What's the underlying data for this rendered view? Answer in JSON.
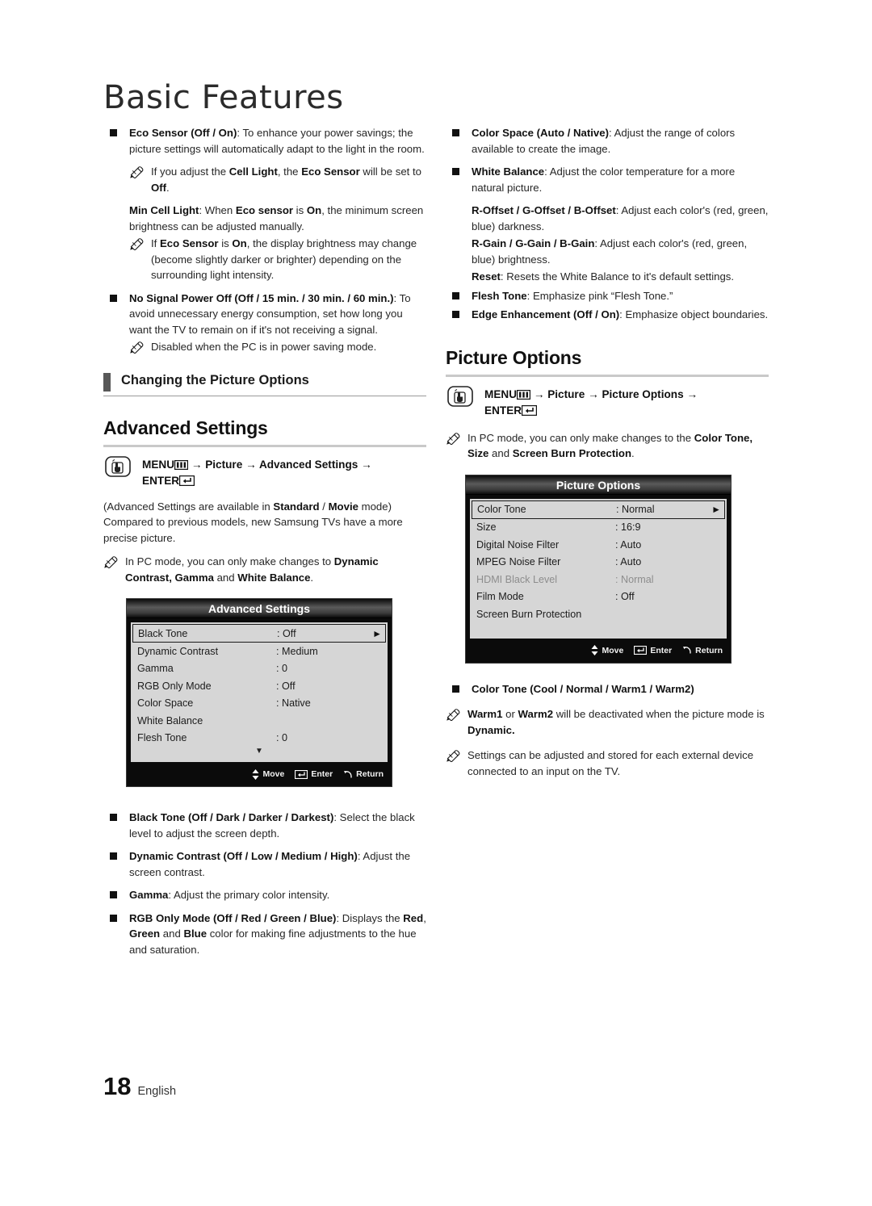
{
  "page": {
    "title": "Basic Features",
    "footer_number": "18",
    "footer_language": "English"
  },
  "left_column": {
    "eco_sensor": {
      "term": "Eco Sensor (Off / On)",
      "text": ": To enhance your power savings; the picture settings will automatically adapt to the light in the room."
    },
    "eco_sensor_note": {
      "pre": "If you adjust the ",
      "b1": "Cell Light",
      "mid": ", the ",
      "b2": "Eco Sensor",
      "mid2": "  will be set to ",
      "b3": "Off",
      "post": "."
    },
    "min_cell_light": {
      "term": "Min Cell Light",
      "pre": ": When ",
      "b1": "Eco sensor",
      "mid": " is ",
      "b2": "On",
      "post": ", the minimum screen brightness can be adjusted manually."
    },
    "min_cell_light_note": {
      "pre": "If ",
      "b1": "Eco Sensor",
      "mid": " is ",
      "b2": "On",
      "post": ", the display brightness may change (become slightly darker or brighter) depending on the surrounding light intensity."
    },
    "no_signal_power_off": {
      "term": "No Signal Power Off (Off / 15 min. / 30 min. / 60 min.)",
      "text": ": To avoid unnecessary energy consumption, set how long you want the TV to remain on if it's not receiving a signal."
    },
    "no_signal_note": "Disabled when the PC is in power saving mode.",
    "section_heading": "Changing the Picture Options",
    "advanced_settings_heading": "Advanced Settings",
    "advanced_menu_path": {
      "menu": "MENU",
      "menu_icon": "menu-grid-icon",
      "arrow1": "→",
      "step1": "Picture",
      "arrow2": "→",
      "step2": "Advanced Settings",
      "arrow3": "→",
      "enter": "ENTER",
      "enter_icon": "enter-key-icon",
      "hand_icon": "hand-press-icon"
    },
    "advanced_intro": {
      "pre": "(Advanced Settings are available in ",
      "b1": "Standard",
      "mid": " / ",
      "b2": "Movie",
      "post": " mode) Compared to previous models, new Samsung TVs have a more precise picture."
    },
    "advanced_pc_note": {
      "pre": "In PC mode, you can only make changes to ",
      "b1": "Dynamic Contrast, Gamma",
      "mid": " and ",
      "b2": "White Balance",
      "post": "."
    },
    "advanced_osd": {
      "title": "Advanced Settings",
      "rows": [
        {
          "label": "Black Tone",
          "value": ": Off",
          "selected": true,
          "arrow": "►",
          "dim": false
        },
        {
          "label": "Dynamic Contrast",
          "value": ": Medium",
          "selected": false,
          "arrow": "",
          "dim": false
        },
        {
          "label": "Gamma",
          "value": ": 0",
          "selected": false,
          "arrow": "",
          "dim": false
        },
        {
          "label": "RGB Only Mode",
          "value": ": Off",
          "selected": false,
          "arrow": "",
          "dim": false
        },
        {
          "label": "Color Space",
          "value": ": Native",
          "selected": false,
          "arrow": "",
          "dim": false
        },
        {
          "label": "White Balance",
          "value": "",
          "selected": false,
          "arrow": "",
          "dim": false
        },
        {
          "label": "Flesh Tone",
          "value": ": 0",
          "selected": false,
          "arrow": "",
          "dim": false
        }
      ],
      "scroll_indicator": "▼",
      "footer": {
        "move": "Move",
        "enter": "Enter",
        "return": "Return"
      }
    },
    "black_tone": {
      "term": "Black Tone (Off / Dark / Darker / Darkest)",
      "text": ": Select the black level to adjust the screen depth."
    },
    "dynamic_contrast": {
      "term": "Dynamic Contrast (Off / Low / Medium / High)",
      "text": ": Adjust the screen contrast."
    },
    "gamma": {
      "term": "Gamma",
      "text": ": Adjust the primary color intensity."
    },
    "rgb_only_mode": {
      "term": "RGB Only Mode (Off / Red / Green / Blue)",
      "pre": ": Displays the ",
      "b1": "Red",
      "mid1": ", ",
      "b2": "Green",
      "mid2": " and ",
      "b3": "Blue",
      "post": " color for making fine adjustments to the hue and saturation."
    }
  },
  "right_column": {
    "color_space": {
      "term": "Color Space (Auto / Native)",
      "text": ": Adjust the range of colors available to create the image."
    },
    "white_balance": {
      "term": "White Balance",
      "text": ": Adjust the color temperature for a more natural picture."
    },
    "offsets": {
      "term": "R-Offset / G-Offset / B-Offset",
      "text": ": Adjust each color's (red, green, blue) darkness."
    },
    "gains": {
      "term": "R-Gain / G-Gain / B-Gain",
      "text": ": Adjust each color's (red, green, blue) brightness."
    },
    "reset": {
      "term": "Reset",
      "text": ": Resets the White Balance to it's default settings."
    },
    "flesh_tone": {
      "term": "Flesh Tone",
      "text": ": Emphasize pink “Flesh Tone.”"
    },
    "edge_enhancement": {
      "term": "Edge Enhancement (Off / On)",
      "text": ": Emphasize object boundaries."
    },
    "picture_options_heading": "Picture Options",
    "picture_menu_path": {
      "menu": "MENU",
      "menu_icon": "menu-grid-icon",
      "arrow1": "→",
      "step1": "Picture",
      "arrow2": "→",
      "step2": "Picture Options",
      "arrow3": "→",
      "enter": "ENTER",
      "enter_icon": "enter-key-icon",
      "hand_icon": "hand-press-icon"
    },
    "picture_pc_note": {
      "pre": "In PC mode, you can only make changes to the ",
      "b1": "Color Tone, Size",
      "mid": " and ",
      "b2": "Screen Burn Protection",
      "post": "."
    },
    "picture_osd": {
      "title": "Picture Options",
      "rows": [
        {
          "label": "Color Tone",
          "value": ": Normal",
          "selected": true,
          "arrow": "►",
          "dim": false
        },
        {
          "label": "Size",
          "value": ": 16:9",
          "selected": false,
          "arrow": "",
          "dim": false
        },
        {
          "label": "Digital Noise Filter",
          "value": ": Auto",
          "selected": false,
          "arrow": "",
          "dim": false
        },
        {
          "label": "MPEG Noise Filter",
          "value": ": Auto",
          "selected": false,
          "arrow": "",
          "dim": false
        },
        {
          "label": "HDMI Black Level",
          "value": ": Normal",
          "selected": false,
          "arrow": "",
          "dim": true
        },
        {
          "label": "Film Mode",
          "value": ": Off",
          "selected": false,
          "arrow": "",
          "dim": false
        },
        {
          "label": "Screen Burn Protection",
          "value": "",
          "selected": false,
          "arrow": "",
          "dim": false
        }
      ],
      "footer": {
        "move": "Move",
        "enter": "Enter",
        "return": "Return"
      }
    },
    "color_tone_bullet": {
      "term": "Color Tone (Cool / Normal / Warm1 / Warm2)",
      "text": ""
    },
    "warm_note": {
      "b1": "Warm1",
      "mid1": " or ",
      "b2": "Warm2",
      "mid2": " will be deactivated when the picture mode is ",
      "b3": "Dynamic.",
      "post": ""
    },
    "stored_note": "Settings can be adjusted and stored for each external device connected to an input on the TV."
  },
  "colors": {
    "text": "#262626",
    "bar": "#585858",
    "rule": "#c9c9c9",
    "osd_panel": "#d6d6d6",
    "osd_dark": "#0b0b0b"
  }
}
